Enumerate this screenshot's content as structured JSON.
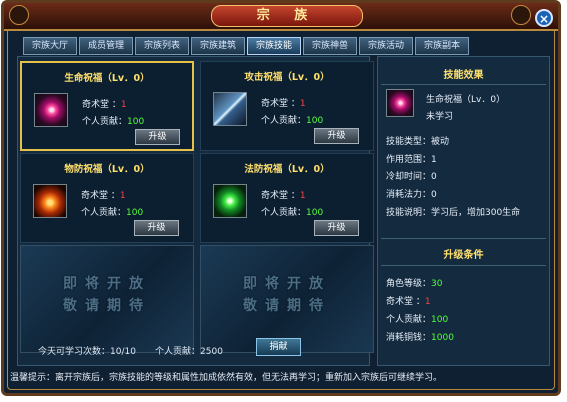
{
  "title": "宗 族",
  "tabs": [
    "宗族大厅",
    "成员管理",
    "宗族列表",
    "宗族建筑",
    "宗族技能",
    "宗族神兽",
    "宗族活动",
    "宗族副本"
  ],
  "skills": [
    {
      "title": "生命祝福（Lv．0）",
      "qishutang_label": "奇术堂 ：",
      "qishutang_value": "1",
      "contrib_label": "个人贡献：",
      "contrib_value": "100",
      "button": "升级"
    },
    {
      "title": "攻击祝福（Lv．0）",
      "qishutang_label": "奇术堂 ：",
      "qishutang_value": "1",
      "contrib_label": "个人贡献：",
      "contrib_value": "100",
      "button": "升级"
    },
    {
      "title": "物防祝福（Lv．0）",
      "qishutang_label": "奇术堂 ：",
      "qishutang_value": "1",
      "contrib_label": "个人贡献：",
      "contrib_value": "100",
      "button": "升级"
    },
    {
      "title": "法防祝福（Lv．0）",
      "qishutang_label": "奇术堂 ：",
      "qishutang_value": "1",
      "contrib_label": "个人贡献：",
      "contrib_value": "100",
      "button": "升级"
    }
  ],
  "locked_text": [
    "即将开放",
    "敬请期待"
  ],
  "footer": {
    "times_label": "今天可学习次数：",
    "times_value": "10/10",
    "contrib_label": "个人贡献：",
    "contrib_value": "2500",
    "donate": "捐献"
  },
  "effect": {
    "header": "技能效果",
    "name": "生命祝福（Lv．0）",
    "state": "未学习",
    "type": "技能类型：被动",
    "range": "作用范围：1",
    "cooldown": "冷却时间：0",
    "mana": "消耗法力：0",
    "desc": "技能说明：学习后，增加300生命"
  },
  "upgrade": {
    "header": "升级条件",
    "level_label": "角色等级：",
    "level_value": "30",
    "hall_label": "奇术堂 ：",
    "hall_value": "1",
    "contrib_label": "个人贡献：",
    "contrib_value": "100",
    "money_label": "消耗铜钱：",
    "money_value": "1000"
  },
  "tip": "温馨提示：离开宗族后，宗族技能的等级和属性加成依然有效，但无法再学习；重新加入宗族后可继续学习。"
}
